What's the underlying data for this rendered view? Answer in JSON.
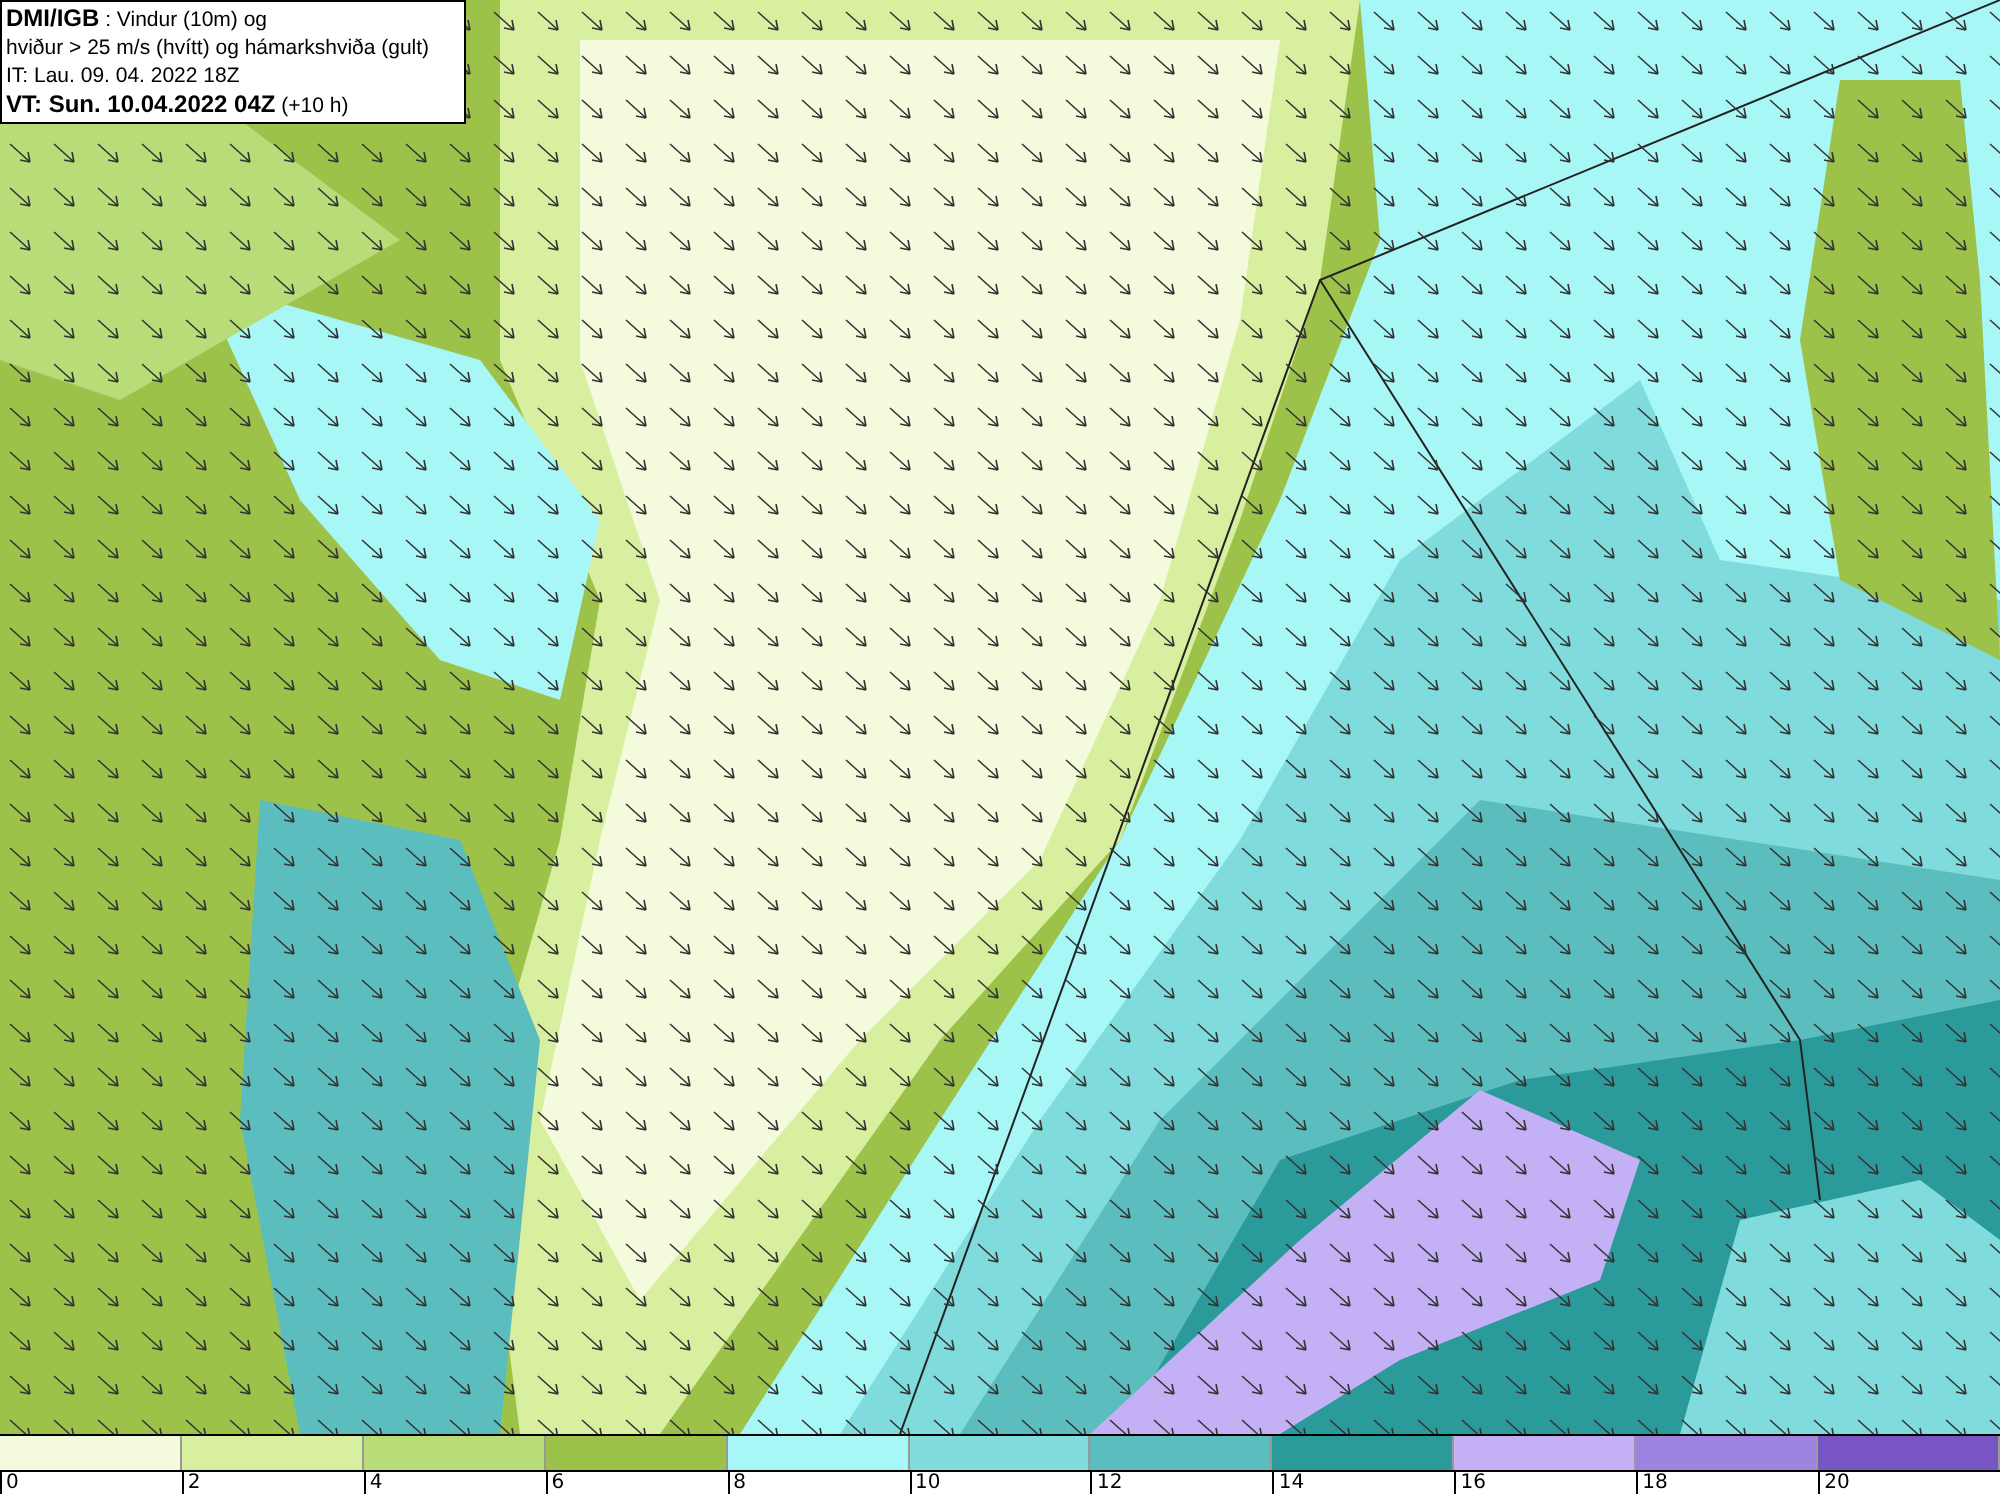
{
  "header": {
    "line_1": "**DMI/IGB** : Vindur (10m) og",
    "line_2": "hviður > 25 m/s (hvítt) og hámarkshviða (gult)",
    "line_3": "IT: Lau. 09. 04. 2022 18Z",
    "line_4": "**VT: Sun. 10.04.2022 04Z** (+10 h)"
  },
  "legend": {
    "bins": [
      {
        "color": "#f4fbdc"
      },
      {
        "color": "#d9efa0"
      },
      {
        "color": "#b8dc78"
      },
      {
        "color": "#9cc24a"
      },
      {
        "color": "#a8f7f7"
      },
      {
        "color": "#80dcdc"
      },
      {
        "color": "#5bbdbd"
      },
      {
        "color": "#2a9a9a"
      },
      {
        "color": "#c4b0f5"
      },
      {
        "color": "#9c84e0"
      },
      {
        "color": "#7855c5"
      }
    ],
    "ticks": [
      "0",
      "2",
      "4",
      "6",
      "8",
      "10",
      "12",
      "14",
      "16",
      "18",
      "20"
    ]
  }
}
